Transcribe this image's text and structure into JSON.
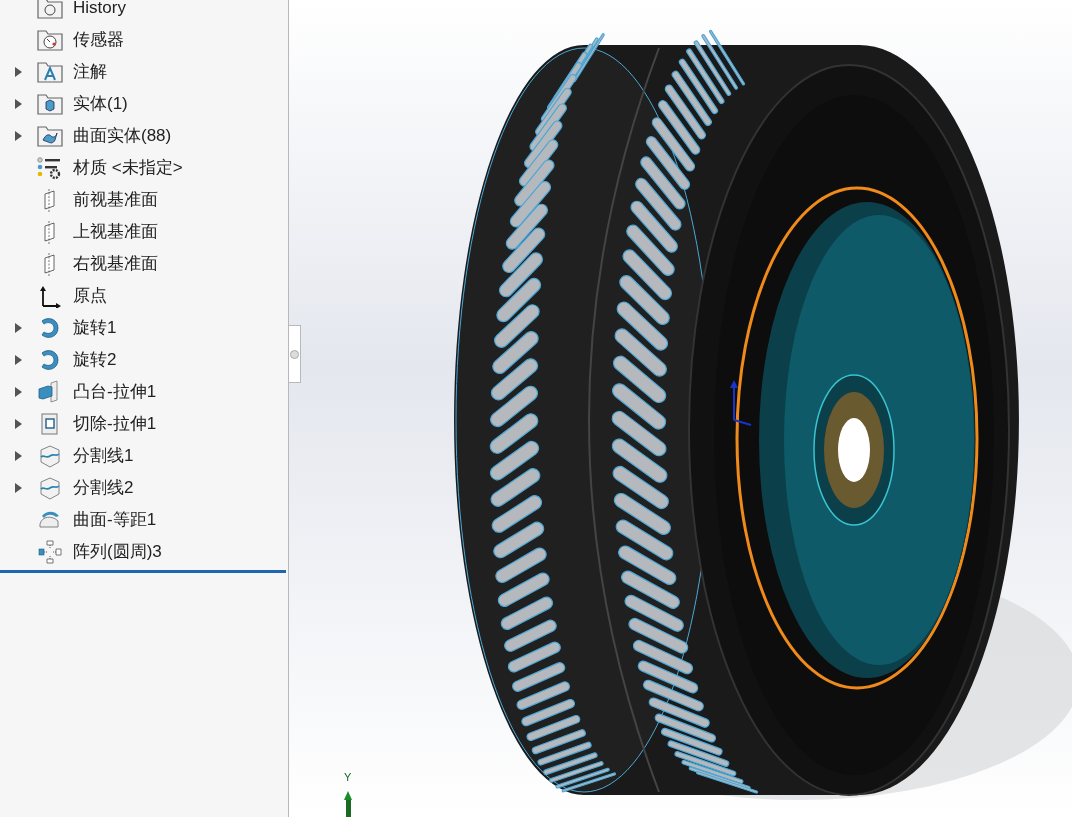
{
  "feature_tree": {
    "items": [
      {
        "label": "History",
        "kind": "history",
        "expandable": false
      },
      {
        "label": "传感器",
        "kind": "sensor",
        "expandable": false
      },
      {
        "label": "注解",
        "kind": "annotation",
        "expandable": true
      },
      {
        "label": "实体(1)",
        "kind": "solid",
        "expandable": true
      },
      {
        "label": "曲面实体(88)",
        "kind": "surface",
        "expandable": true
      },
      {
        "label": "材质 <未指定>",
        "kind": "material",
        "expandable": false
      },
      {
        "label": "前视基准面",
        "kind": "plane",
        "expandable": false
      },
      {
        "label": "上视基准面",
        "kind": "plane",
        "expandable": false
      },
      {
        "label": "右视基准面",
        "kind": "plane",
        "expandable": false
      },
      {
        "label": "原点",
        "kind": "origin",
        "expandable": false
      },
      {
        "label": "旋转1",
        "kind": "revolve",
        "expandable": true
      },
      {
        "label": "旋转2",
        "kind": "revolve",
        "expandable": true
      },
      {
        "label": "凸台-拉伸1",
        "kind": "extrude",
        "expandable": true
      },
      {
        "label": "切除-拉伸1",
        "kind": "cut",
        "expandable": true
      },
      {
        "label": "分割线1",
        "kind": "split",
        "expandable": true
      },
      {
        "label": "分割线2",
        "kind": "split",
        "expandable": true
      },
      {
        "label": "曲面-等距1",
        "kind": "offset",
        "expandable": false
      },
      {
        "label": "阵列(圆周)3",
        "kind": "pattern",
        "expandable": false
      }
    ]
  },
  "viewport": {
    "triad_label": "Y"
  }
}
